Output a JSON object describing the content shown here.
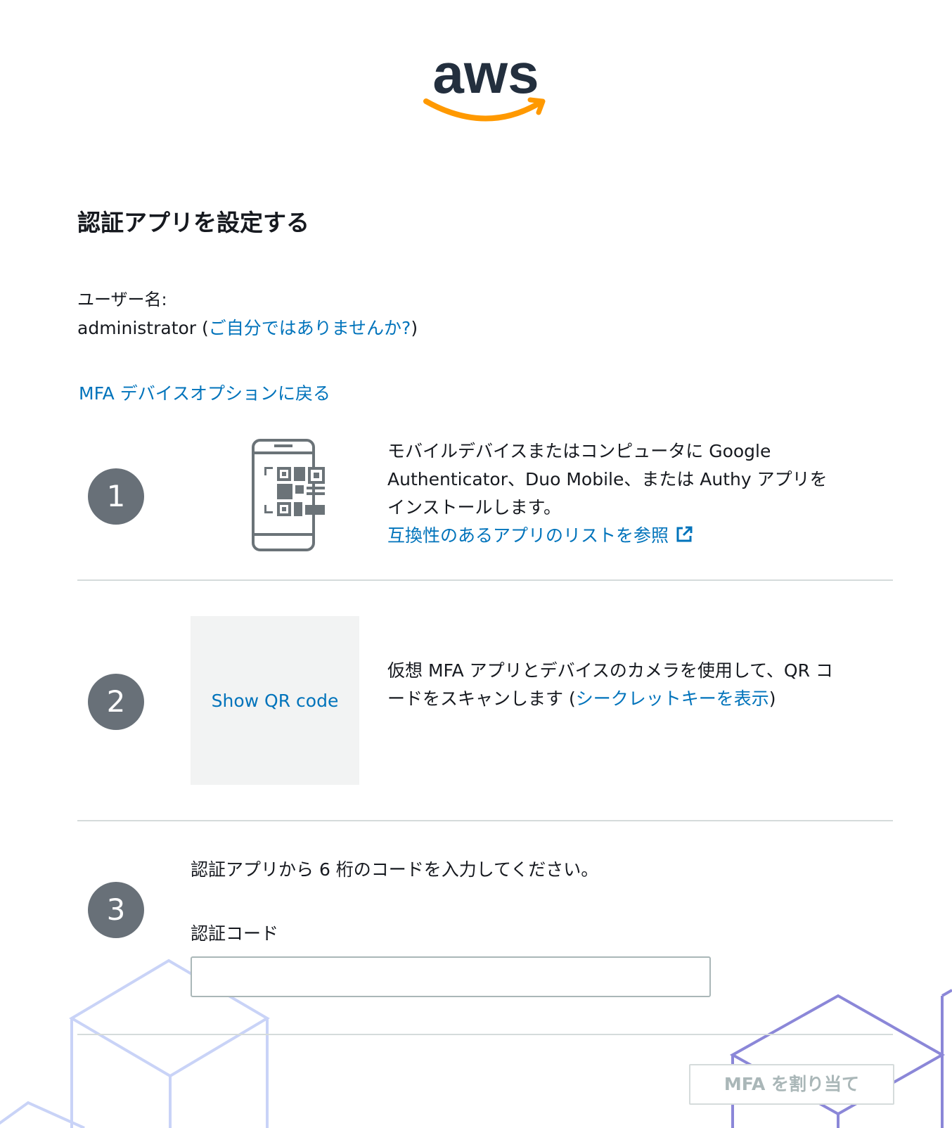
{
  "logo": {
    "text": "aws",
    "colors": {
      "text": "#232f3e",
      "smile": "#ff9900"
    }
  },
  "title": "認証アプリを設定する",
  "user": {
    "label": "ユーザー名:",
    "name": "administrator",
    "open_paren": " (",
    "not_you_link": "ご自分ではありませんか?",
    "close_paren": ")"
  },
  "back_link": "MFA デバイスオプションに戻る",
  "steps": [
    {
      "number": "1",
      "text": "モバイルデバイスまたはコンピュータに Google Authenticator、Duo Mobile、または Authy アプリをインストールします。",
      "link": "互換性のあるアプリのリストを参照"
    },
    {
      "number": "2",
      "qr_button": "Show QR code",
      "text": "仮想 MFA アプリとデバイスのカメラを使用して、QR コードをスキャンします (",
      "link": "シークレットキーを表示",
      "suffix": ")"
    },
    {
      "number": "3",
      "instruction": "認証アプリから 6 桁のコードを入力してください。",
      "code_label": "認証コード",
      "code_value": ""
    }
  ],
  "assign_button": "MFA を割り当て",
  "colors": {
    "link": "#0073bb",
    "step_circle": "#687078",
    "divider": "#d5dbdb"
  }
}
